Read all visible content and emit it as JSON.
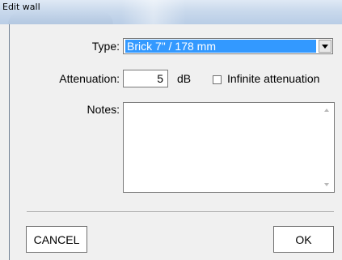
{
  "window": {
    "title": "Edit wall"
  },
  "form": {
    "type_label": "Type:",
    "type_value": "Brick 7\" / 178 mm",
    "attenuation_label": "Attenuation:",
    "attenuation_value": "5",
    "attenuation_unit": "dB",
    "infinite_label": "Infinite attenuation",
    "infinite_checked": false,
    "notes_label": "Notes:",
    "notes_value": ""
  },
  "buttons": {
    "cancel": "CANCEL",
    "ok": "OK"
  },
  "colors": {
    "selection": "#3399ff",
    "titlebar": "#c9d9ec",
    "dialog_bg": "#f0f0f0"
  }
}
